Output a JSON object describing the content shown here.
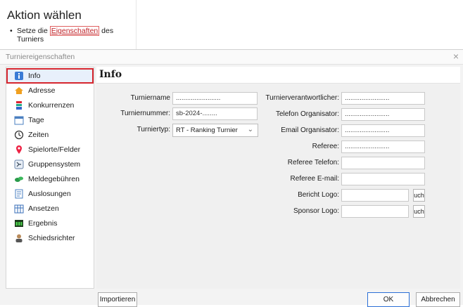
{
  "background": {
    "title": "Aktion wählen",
    "instruction_prefix": "Setze die ",
    "instruction_link": "Eigenschaften",
    "instruction_suffix": " des",
    "instruction_line2": "Turniers"
  },
  "dialog": {
    "title": "Turniereigenschaften",
    "close_glyph": "×",
    "page_title": "Info",
    "sidebar": [
      {
        "label": "Info",
        "icon": "info-icon",
        "selected": true
      },
      {
        "label": "Adresse",
        "icon": "home-icon"
      },
      {
        "label": "Konkurrenzen",
        "icon": "competitions-icon"
      },
      {
        "label": "Tage",
        "icon": "calendar-icon"
      },
      {
        "label": "Zeiten",
        "icon": "clock-icon"
      },
      {
        "label": "Spielorte/Felder",
        "icon": "location-pin-icon"
      },
      {
        "label": "Gruppensystem",
        "icon": "groups-icon"
      },
      {
        "label": "Meldegebühren",
        "icon": "money-icon"
      },
      {
        "label": "Auslosungen",
        "icon": "draw-icon"
      },
      {
        "label": "Ansetzen",
        "icon": "schedule-icon"
      },
      {
        "label": "Ergebnis",
        "icon": "result-icon"
      },
      {
        "label": "Schiedsrichter",
        "icon": "referee-icon"
      }
    ],
    "form": {
      "name_label": "Turniername",
      "name_value": "........................",
      "number_label": "Turniernummer:",
      "number_value": "sb-2024-........",
      "type_label": "Turniertyp:",
      "type_value": "RT - Ranking Turnier",
      "responsible_label": "Turnierverantwortlicher:",
      "responsible_value": "........................",
      "phone_label": "Telefon Organisator:",
      "phone_value": "........................",
      "email_label": "Email Organisator:",
      "email_value": "........................",
      "referee_label": "Referee:",
      "referee_value": "........................",
      "referee_phone_label": "Referee Telefon:",
      "referee_phone_value": "",
      "referee_email_label": "Referee E-mail:",
      "referee_email_value": "",
      "report_logo_label": "Bericht Logo:",
      "report_logo_value": "",
      "sponsor_logo_label": "Sponsor Logo:",
      "sponsor_logo_value": "",
      "browse_label": "uch"
    },
    "buttons": {
      "import": "Importieren",
      "ok": "OK",
      "cancel": "Abbrechen"
    }
  },
  "colors": {
    "selection_outline": "#d6262e",
    "ok_border": "#2b6fd6"
  }
}
